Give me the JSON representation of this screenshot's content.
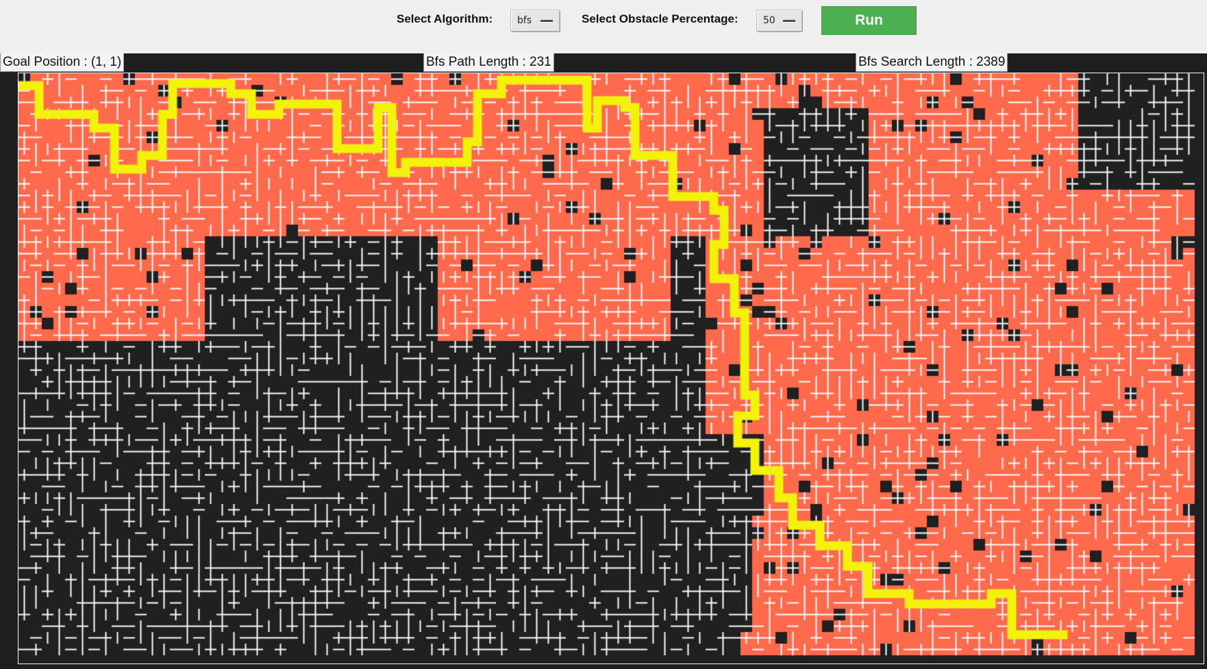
{
  "toolbar": {
    "algorithm_label": "Select Algorithm:",
    "algorithm_value": "bfs",
    "obstacle_label": "Select Obstacle Percentage:",
    "obstacle_value": "50",
    "run_label": "Run"
  },
  "info": {
    "goal_position": "Goal Position : (1, 1)",
    "path_length": "Bfs Path Length : 231",
    "search_length": "Bfs Search Length : 2389"
  },
  "maze": {
    "colors": {
      "background": "#1e1e1e",
      "wall": "#202020",
      "passage": "#ffffff",
      "visited": "#ff6a4d",
      "path": "#f2f20a",
      "button": "#4caf50"
    },
    "algorithm": "bfs",
    "obstacle_percentage": 50
  },
  "icons": {
    "dropdown_indicator": "dropdown-indicator-icon"
  }
}
